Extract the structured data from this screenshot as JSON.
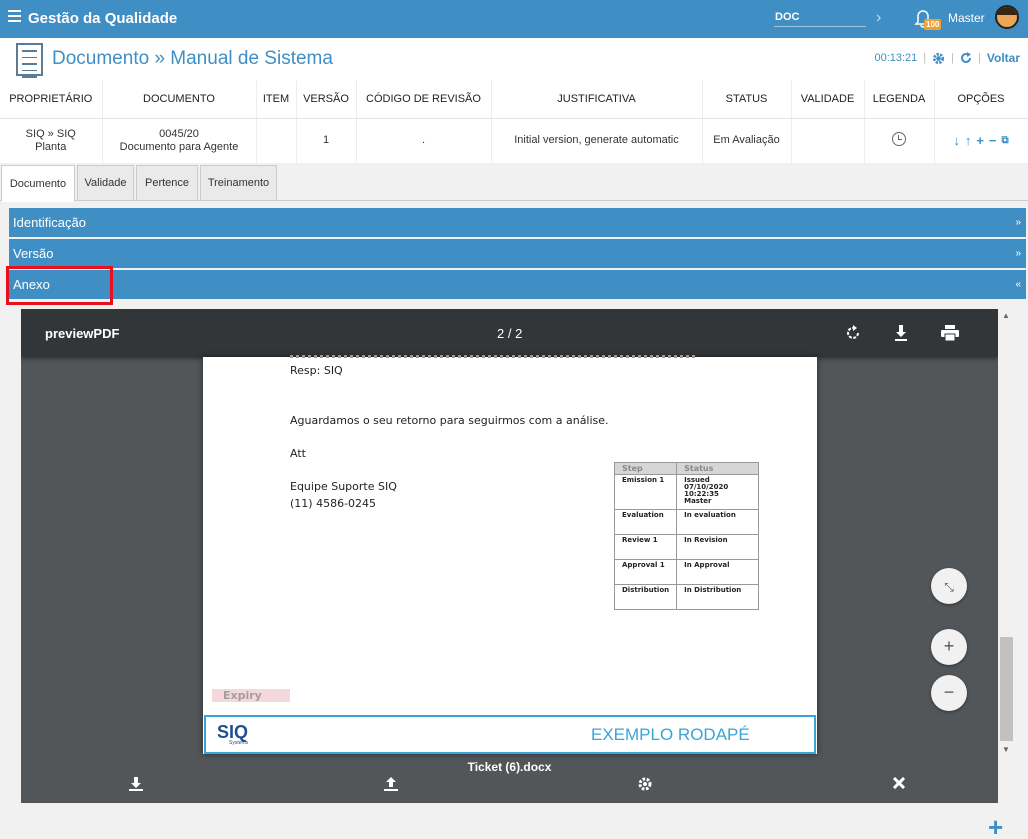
{
  "topbar": {
    "app_title": "Gestão da Qualidade",
    "search_value": "DOC",
    "notifications": "100",
    "user": "Master"
  },
  "title": {
    "text": "Documento » Manual de Sistema",
    "timer": "00:13:21",
    "back_label": "Voltar"
  },
  "table": {
    "headers": [
      "PROPRIETÁRIO",
      "DOCUMENTO",
      "ITEM",
      "VERSÃO",
      "CÓDIGO DE REVISÃO",
      "JUSTIFICATIVA",
      "STATUS",
      "VALIDADE",
      "LEGENDA",
      "OPÇÕES"
    ],
    "row": {
      "owner_line1": "SIQ » SIQ",
      "owner_line2": "Planta",
      "doc_line1": "0045/20",
      "doc_line2": "Documento para Agente",
      "item": "",
      "version": "1",
      "revision_code": ".",
      "justification": "Initial version, generate automatic",
      "status": "Em Avaliação",
      "validity": ""
    }
  },
  "tabs": [
    "Documento",
    "Validade",
    "Pertence",
    "Treinamento"
  ],
  "panels": {
    "identificacao": "Identificação",
    "versao": "Versão",
    "anexo": "Anexo",
    "collapsed_chevron": "»",
    "expanded_chevron": "«"
  },
  "viewer": {
    "name": "previewPDF",
    "page": "2 / 2",
    "filename": "Ticket (6).docx",
    "doc_lines": [
      "Resp: SIQ",
      "Aguardamos o seu retorno para seguirmos com a análise.",
      "Att",
      "Equipe Suporte SIQ",
      "(11) 4586-0245"
    ],
    "step_table": {
      "headers": [
        "Step",
        "Status"
      ],
      "rows": [
        [
          "Emission 1",
          "Issued\n07/10/2020 10:22:35\nMaster"
        ],
        [
          "Evaluation",
          "In evaluation"
        ],
        [
          "Review 1",
          "In Revision"
        ],
        [
          "Approval 1",
          "In Approval"
        ],
        [
          "Distribution",
          "In Distribution"
        ]
      ]
    },
    "expiry_label": "Expiry",
    "footer_logo": "SIQ",
    "footer_logo_sub": "Systems",
    "footer_text": "EXEMPLO RODAPÉ"
  },
  "colors": {
    "brand": "#3f8fc4",
    "highlight": "#e8101c",
    "viewer_bg": "#525659",
    "footer_accent": "#37a5d8"
  }
}
